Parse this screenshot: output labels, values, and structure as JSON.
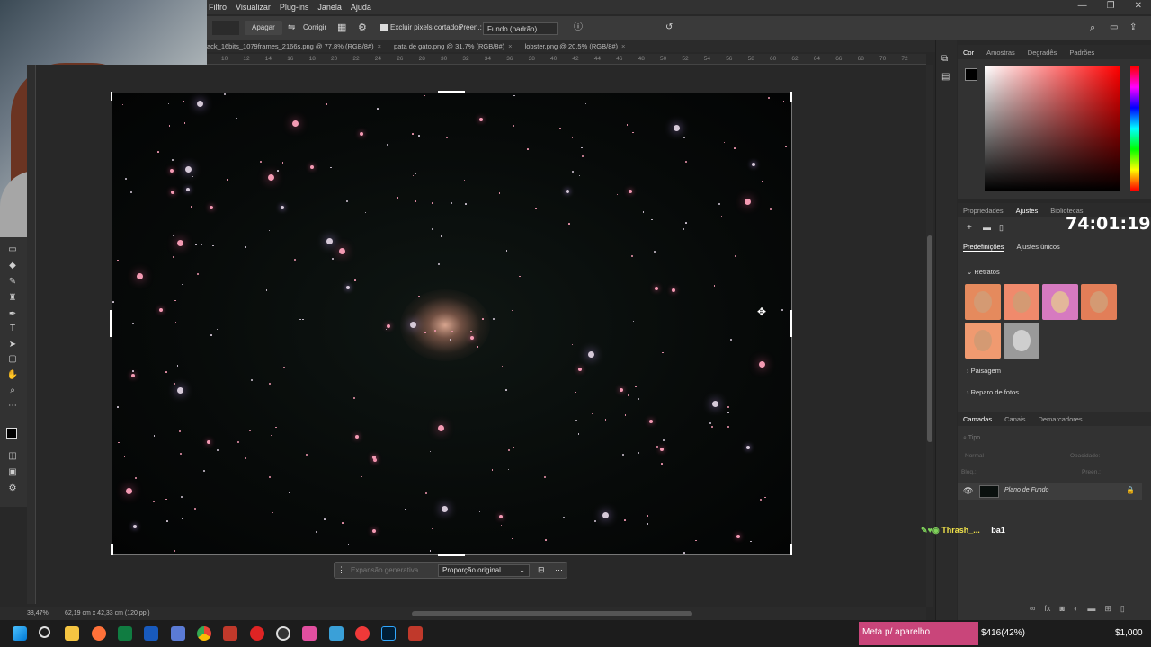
{
  "app": {
    "menus": [
      "Filtro",
      "Visualizar",
      "Plug-ins",
      "Janela",
      "Ajuda"
    ]
  },
  "options": {
    "clear": "Apagar",
    "straighten": "Corrigir",
    "delete_cropped": "Excluir pixels cortados",
    "fill_label": "Preen.:",
    "fill_value": "Fundo (padrão)"
  },
  "tabs": [
    "ack_16bits_1079frames_2166s.png @ 77,8% (RGB/8#)",
    "pata de gato.png @ 31,7% (RGB/8#)",
    "lobster.png @ 20,5% (RGB/8#)"
  ],
  "ruler": {
    "ticks": [
      "10",
      "12",
      "14",
      "16",
      "18",
      "20",
      "22",
      "24",
      "26",
      "28",
      "30",
      "32",
      "34",
      "36",
      "38",
      "40",
      "42",
      "44",
      "46",
      "48",
      "50",
      "52",
      "54",
      "56",
      "58",
      "60",
      "62",
      "64",
      "66",
      "68",
      "70",
      "72"
    ]
  },
  "contextbar": {
    "generative": "Expansão generativa",
    "ratio": "Proporção original"
  },
  "status": {
    "zoom": "38,47%",
    "doc_info": "62,19 cm x 42,33 cm (120 ppi)"
  },
  "color_panel": {
    "tabs": [
      "Cor",
      "Amostras",
      "Degradês",
      "Padrões"
    ]
  },
  "adjust_panel": {
    "tabs": [
      "Propriedades",
      "Ajustes",
      "Bibliotecas"
    ],
    "subtabs": [
      "Predefinições",
      "Ajustes únicos"
    ],
    "sections": [
      "Retratos",
      "Paisagem",
      "Reparo de fotos"
    ]
  },
  "layers_panel": {
    "tabs": [
      "Camadas",
      "Canais",
      "Demarcadores"
    ],
    "search": "Tipo",
    "blend": "Normal",
    "opacity_label": "Opacidade:",
    "lock_label": "Bloq.:",
    "fill_label": "Preen.:",
    "layer_name": "Plano de Fundo"
  },
  "overlay": {
    "timer": "74:01:19",
    "chat_user": "Thrash_...",
    "chat_message": "ba1",
    "goal_label": "Meta p/ aparelho",
    "goal_progress": "$416(42%)",
    "goal_target": "$1,000",
    "goal_fraction": 0.42
  },
  "colors": {
    "accent_pink": "#c9457a",
    "chat_user": "#f0e24a"
  }
}
